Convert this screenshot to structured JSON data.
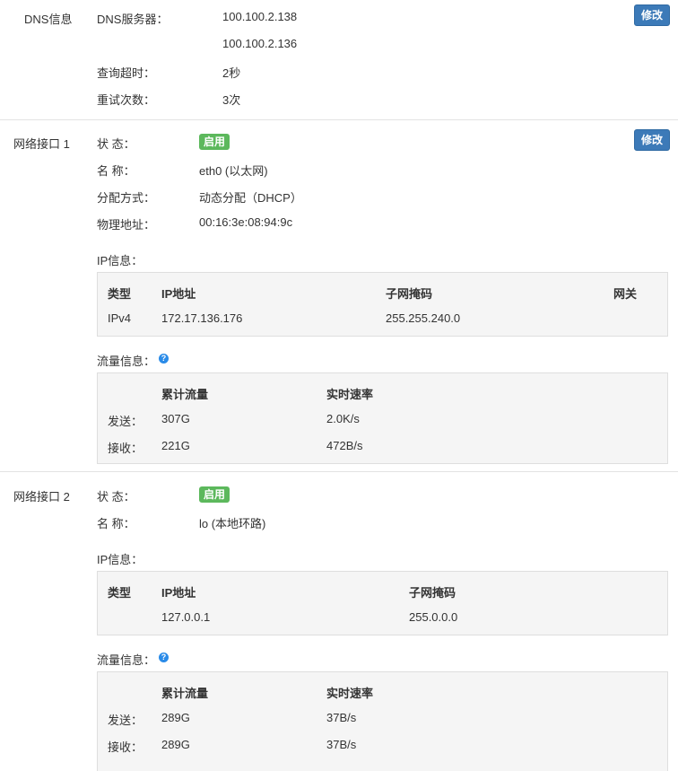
{
  "dns": {
    "section_label": "DNS信息",
    "edit_label": "修改",
    "server_label": "DNS服务器：",
    "servers": [
      "100.100.2.138",
      "100.100.2.136"
    ],
    "timeout_label": "查询超时：",
    "timeout_value": "2秒",
    "retry_label": "重试次数：",
    "retry_value": "3次"
  },
  "interfaces": [
    {
      "section_label": "网络接口 1",
      "edit_label": "修改",
      "status_label": "状 态：",
      "status_value": "启用",
      "name_label": "名 称：",
      "name_value": "eth0 (以太网)",
      "alloc_label": "分配方式：",
      "alloc_value": "动态分配（DHCP）",
      "mac_label": "物理地址：",
      "mac_value": "00:16:3e:08:94:9c",
      "ip_info_label": "IP信息：",
      "ip_headers": [
        "类型",
        "IP地址",
        "子网掩码",
        "网关"
      ],
      "ip_row": [
        "IPv4",
        "172.17.136.176",
        "255.255.240.0",
        ""
      ],
      "traffic_label": "流量信息：",
      "help_icon": "?",
      "traffic_headers": [
        "累计流量",
        "实时速率"
      ],
      "traffic_rows": [
        {
          "label": "发送：",
          "total": "307G",
          "rate": "2.0K/s"
        },
        {
          "label": "接收：",
          "total": "221G",
          "rate": "472B/s"
        }
      ]
    },
    {
      "section_label": "网络接口 2",
      "status_label": "状 态：",
      "status_value": "启用",
      "name_label": "名 称：",
      "name_value": "lo (本地环路)",
      "ip_info_label": "IP信息：",
      "ip_headers": [
        "类型",
        "IP地址",
        "子网掩码"
      ],
      "ip_row": [
        "",
        "127.0.0.1",
        "255.0.0.0"
      ],
      "traffic_label": "流量信息：",
      "help_icon": "?",
      "traffic_headers": [
        "累计流量",
        "实时速率"
      ],
      "traffic_rows": [
        {
          "label": "发送：",
          "total": "289G",
          "rate": "37B/s"
        },
        {
          "label": "接收：",
          "total": "289G",
          "rate": "37B/s"
        }
      ]
    }
  ],
  "colors": {
    "edit_button": "#3c7ab8",
    "status_badge": "#5cb85c",
    "help_icon": "#2a8be8",
    "table_bg": "#f5f5f5"
  }
}
